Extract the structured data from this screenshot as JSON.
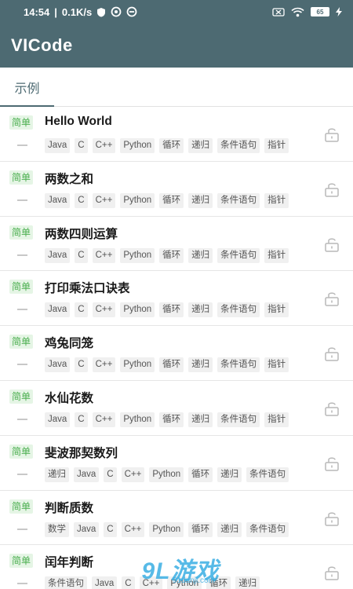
{
  "status_bar": {
    "time": "14:54",
    "speed": "0.1K/s",
    "battery": "65"
  },
  "app": {
    "title": "VICode"
  },
  "tabs": [
    {
      "label": "示例"
    }
  ],
  "items": [
    {
      "badge": "简单",
      "title": "Hello World",
      "tags": [
        "Java",
        "C",
        "C++",
        "Python",
        "循环",
        "递归",
        "条件语句",
        "指针"
      ]
    },
    {
      "badge": "简单",
      "title": "两数之和",
      "tags": [
        "Java",
        "C",
        "C++",
        "Python",
        "循环",
        "递归",
        "条件语句",
        "指针"
      ]
    },
    {
      "badge": "简单",
      "title": "两数四则运算",
      "tags": [
        "Java",
        "C",
        "C++",
        "Python",
        "循环",
        "递归",
        "条件语句",
        "指针"
      ]
    },
    {
      "badge": "简单",
      "title": "打印乘法口诀表",
      "tags": [
        "Java",
        "C",
        "C++",
        "Python",
        "循环",
        "递归",
        "条件语句",
        "指针"
      ]
    },
    {
      "badge": "简单",
      "title": "鸡兔同笼",
      "tags": [
        "Java",
        "C",
        "C++",
        "Python",
        "循环",
        "递归",
        "条件语句",
        "指针"
      ]
    },
    {
      "badge": "简单",
      "title": "水仙花数",
      "tags": [
        "Java",
        "C",
        "C++",
        "Python",
        "循环",
        "递归",
        "条件语句",
        "指针"
      ]
    },
    {
      "badge": "简单",
      "title": "斐波那契数列",
      "tags": [
        "递归",
        "Java",
        "C",
        "C++",
        "Python",
        "循环",
        "递归",
        "条件语句"
      ]
    },
    {
      "badge": "简单",
      "title": "判断质数",
      "tags": [
        "数学",
        "Java",
        "C",
        "C++",
        "Python",
        "循环",
        "递归",
        "条件语句"
      ]
    },
    {
      "badge": "简单",
      "title": "闰年判断",
      "tags": [
        "条件语句",
        "Java",
        "C",
        "C++",
        "Python",
        "循环",
        "递归"
      ]
    }
  ],
  "watermark": {
    "text": "9L游戏",
    "sub": "91danji.com"
  }
}
